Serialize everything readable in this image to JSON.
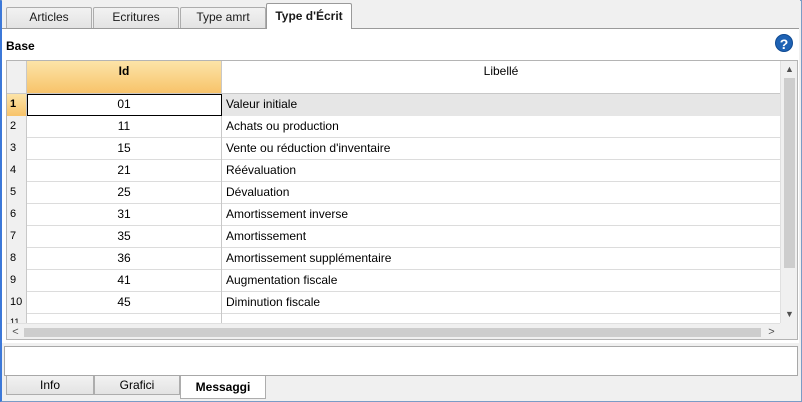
{
  "top_tabs": [
    {
      "label": "Articles"
    },
    {
      "label": "Ecritures"
    },
    {
      "label": "Type amrt"
    },
    {
      "label": "Type d'Écrit"
    }
  ],
  "panel": {
    "section_label": "Base",
    "help_icon": "?"
  },
  "grid": {
    "columns": {
      "id": "Id",
      "libelle": "Libellé"
    },
    "rows": [
      {
        "num": "1",
        "id": "01",
        "libelle": "Valeur initiale"
      },
      {
        "num": "2",
        "id": "11",
        "libelle": "Achats ou production"
      },
      {
        "num": "3",
        "id": "15",
        "libelle": "Vente ou réduction d'inventaire"
      },
      {
        "num": "4",
        "id": "21",
        "libelle": "Réévaluation"
      },
      {
        "num": "5",
        "id": "25",
        "libelle": "Dévaluation"
      },
      {
        "num": "6",
        "id": "31",
        "libelle": "Amortissement inverse"
      },
      {
        "num": "7",
        "id": "35",
        "libelle": "Amortissement"
      },
      {
        "num": "8",
        "id": "36",
        "libelle": "Amortissement supplémentaire"
      },
      {
        "num": "9",
        "id": "41",
        "libelle": "Augmentation fiscale"
      },
      {
        "num": "10",
        "id": "45",
        "libelle": "Diminution fiscale"
      },
      {
        "num": "11",
        "id": "",
        "libelle": ""
      }
    ],
    "selected_row": "1"
  },
  "scrollbars": {
    "up": "▲",
    "down": "▼",
    "left": "<",
    "right": ">"
  },
  "bottom_tabs": [
    {
      "label": "Info"
    },
    {
      "label": "Grafici"
    },
    {
      "label": "Messaggi"
    }
  ]
}
